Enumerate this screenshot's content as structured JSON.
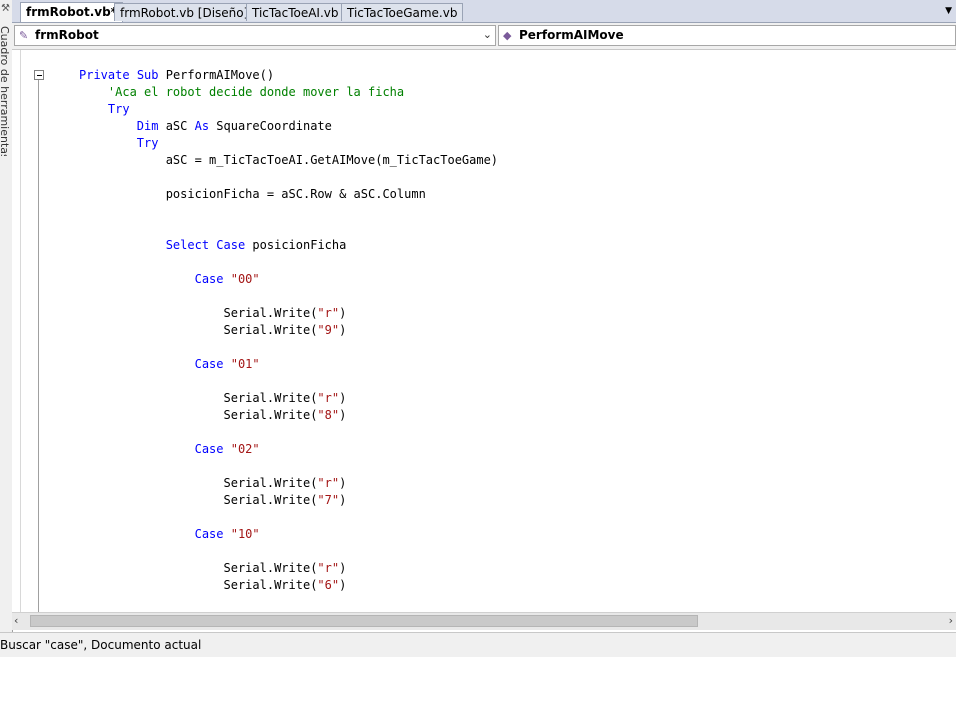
{
  "toolbox": {
    "label": "Cuadro de herramientas",
    "icon": "toolbox-icon"
  },
  "tabs": [
    {
      "label": "frmRobot.vb*",
      "active": true
    },
    {
      "label": "frmRobot.vb [Diseño]*",
      "active": false
    },
    {
      "label": "TicTacToeAI.vb",
      "active": false
    },
    {
      "label": "TicTacToeGame.vb",
      "active": false
    }
  ],
  "nav": {
    "class_combo": "frmRobot",
    "method_combo": "PerformAIMove"
  },
  "code": {
    "sub_kw1": "Private",
    "sub_kw2": "Sub",
    "sub_name": " PerformAIMove()",
    "comment": "'Aca el robot decide donde mover la ficha",
    "try_kw": "Try",
    "dim_kw": "Dim",
    "dim_var": " aSC ",
    "as_kw": "As",
    "dim_type": " SquareCoordinate",
    "try2_kw": "Try",
    "assign1": "aSC = m_TicTacToeAI.GetAIMove(m_TicTacToeGame)",
    "assign2": "posicionFicha = aSC.Row & aSC.Column",
    "select_kw": "Select",
    "case_kw": "Case",
    "select_var": " posicionFicha",
    "cases": [
      {
        "value": "\"00\"",
        "w1": "\"r\"",
        "w2": "\"9\""
      },
      {
        "value": "\"01\"",
        "w1": "\"r\"",
        "w2": "\"8\""
      },
      {
        "value": "\"02\"",
        "w1": "\"r\"",
        "w2": "\"7\""
      },
      {
        "value": "\"10\"",
        "w1": "\"r\"",
        "w2": "\"6\""
      }
    ],
    "serial_write": "Serial.Write(",
    "close_paren": ")"
  },
  "status": {
    "text": "Buscar \"case\", Documento actual"
  },
  "colors": {
    "keyword": "#0000ff",
    "comment": "#008000",
    "string": "#a31515"
  }
}
